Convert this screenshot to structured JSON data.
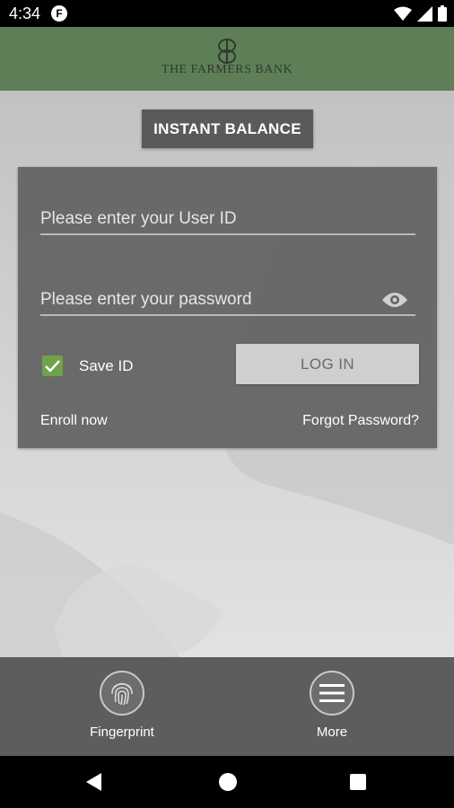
{
  "status_bar": {
    "time": "4:34",
    "app_icon_glyph": "F",
    "icons": [
      "wifi-icon",
      "signal-icon",
      "battery-icon"
    ]
  },
  "header": {
    "logo_text": "THE FARMERS BANK",
    "background_color": "#5e7e58"
  },
  "main": {
    "instant_balance_label": "INSTANT BALANCE",
    "userid_placeholder": "Please enter your User ID",
    "password_placeholder": "Please enter your password",
    "save_id_label": "Save ID",
    "save_id_checked": true,
    "login_label": "LOG IN",
    "enroll_label": "Enroll now",
    "forgot_label": "Forgot Password?",
    "accent_color": "#6fa24a"
  },
  "bottom_bar": {
    "fingerprint_label": "Fingerprint",
    "more_label": "More"
  },
  "nav_bar": {
    "icons": [
      "back-icon",
      "home-icon",
      "recents-icon"
    ]
  }
}
